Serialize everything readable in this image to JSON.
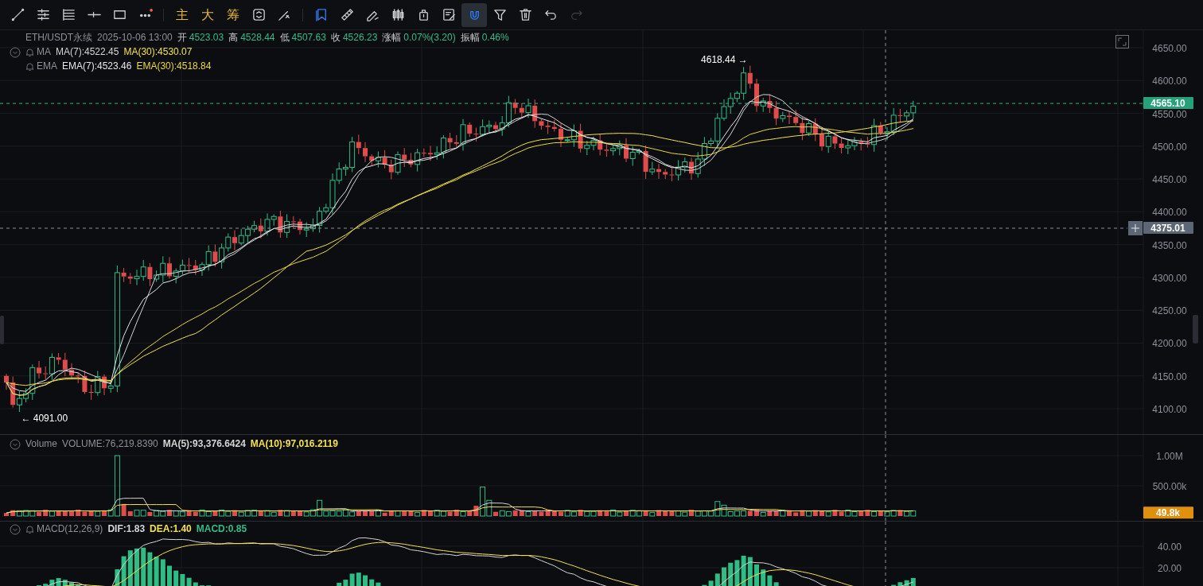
{
  "toolbar": {
    "tools": [
      {
        "kind": "trend-line",
        "selected": false,
        "highlighted": false,
        "disabled": false
      },
      {
        "kind": "parallel-lines",
        "selected": false,
        "highlighted": false,
        "disabled": false
      },
      {
        "kind": "level-lines",
        "selected": false,
        "highlighted": false,
        "disabled": false
      },
      {
        "kind": "horizontal-ray",
        "selected": false,
        "highlighted": false,
        "disabled": false
      },
      {
        "kind": "rectangle",
        "selected": false,
        "highlighted": false,
        "disabled": false
      },
      {
        "kind": "more",
        "selected": false,
        "highlighted": false,
        "disabled": false
      },
      {
        "kind": "separator"
      },
      {
        "kind": "text",
        "label": "主",
        "selected": false,
        "highlighted": false,
        "disabled": false
      },
      {
        "kind": "text",
        "label": "大",
        "selected": false,
        "highlighted": false,
        "disabled": false
      },
      {
        "kind": "text",
        "label": "筹",
        "selected": false,
        "highlighted": false,
        "disabled": false
      },
      {
        "kind": "rotate",
        "selected": false,
        "highlighted": false,
        "disabled": false
      },
      {
        "kind": "brush",
        "selected": false,
        "highlighted": false,
        "disabled": false
      },
      {
        "kind": "separator"
      },
      {
        "kind": "bookmark",
        "selected": false,
        "highlighted": true,
        "disabled": false
      },
      {
        "kind": "ruler",
        "selected": false,
        "highlighted": false,
        "disabled": false
      },
      {
        "kind": "pen",
        "selected": false,
        "highlighted": false,
        "disabled": false
      },
      {
        "kind": "candles",
        "selected": false,
        "highlighted": false,
        "disabled": false
      },
      {
        "kind": "lock",
        "selected": false,
        "highlighted": false,
        "disabled": false
      },
      {
        "kind": "note",
        "selected": false,
        "highlighted": false,
        "disabled": false
      },
      {
        "kind": "magnet",
        "selected": true,
        "highlighted": true,
        "disabled": false
      },
      {
        "kind": "filter",
        "selected": false,
        "highlighted": false,
        "disabled": false
      },
      {
        "kind": "trash",
        "selected": false,
        "highlighted": false,
        "disabled": false
      },
      {
        "kind": "undo",
        "selected": false,
        "highlighted": false,
        "disabled": false
      },
      {
        "kind": "redo",
        "selected": false,
        "highlighted": false,
        "disabled": true
      }
    ]
  },
  "main_pane": {
    "symbol": "ETH/USDT永续",
    "time": "2025-10-06 13:00",
    "stats": [
      {
        "label": "开",
        "value": "4523.03"
      },
      {
        "label": "高",
        "value": "4528.44"
      },
      {
        "label": "低",
        "value": "4507.63"
      },
      {
        "label": "收",
        "value": "4526.23"
      },
      {
        "label": "涨幅",
        "value": "0.07%(3.20)"
      },
      {
        "label": "振幅",
        "value": "0.46%"
      }
    ],
    "indicators": [
      {
        "name": "MA",
        "collapsible": true,
        "values": [
          {
            "text": "MA(7):4522.45",
            "color": "#d4d4d4"
          },
          {
            "text": "MA(30):4530.07",
            "color": "#f2e14c"
          }
        ]
      },
      {
        "name": "EMA",
        "collapsible": false,
        "values": [
          {
            "text": "EMA(7):4523.46",
            "color": "#e6e6e6"
          },
          {
            "text": "EMA(30):4518.84",
            "color": "#e8d83a"
          }
        ]
      }
    ],
    "yticks": [
      "4650.00",
      "4600.00",
      "4550.00",
      "4500.00",
      "4450.00",
      "4400.00",
      "4350.00",
      "4300.00",
      "4250.00",
      "4200.00",
      "4150.00",
      "4100.00"
    ],
    "last_price": "4565.10",
    "crosshair_price": "4375.01",
    "high_label": "4618.44 →",
    "low_label": "← 4091.00"
  },
  "volume_pane": {
    "name": "Volume",
    "values": [
      {
        "text": "VOLUME:76,219.8390",
        "color": "#8b9099"
      },
      {
        "text": "MA(5):93,376.6424",
        "color": "#d4d4d4"
      },
      {
        "text": "MA(10):97,016.2119",
        "color": "#f2e14c"
      }
    ],
    "yticks": [
      "1.00M",
      "500.00k"
    ],
    "last_volume": "49.8k"
  },
  "macd_pane": {
    "name": "MACD(12,26,9)",
    "values": [
      {
        "text": "DIF:1.83",
        "color": "#d4d4d4"
      },
      {
        "text": "DEA:1.40",
        "color": "#f2e14c"
      },
      {
        "text": "MACD:0.85",
        "color": "#2ebd85"
      }
    ],
    "yticks": [
      "40.00",
      "20.00"
    ]
  }
}
